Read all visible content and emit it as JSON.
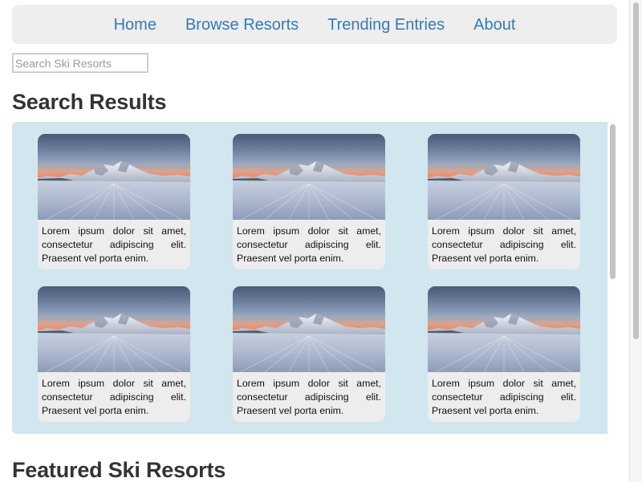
{
  "nav": {
    "items": [
      {
        "label": "Home"
      },
      {
        "label": "Browse Resorts"
      },
      {
        "label": "Trending Entries"
      },
      {
        "label": "About"
      }
    ]
  },
  "search": {
    "placeholder": "Search Ski Resorts",
    "value": ""
  },
  "results": {
    "title": "Search Results",
    "cards": [
      {
        "text": "Lorem ipsum dolor sit amet, consectetur adipiscing elit. Praesent vel porta enim."
      },
      {
        "text": "Lorem ipsum dolor sit amet, consectetur adipiscing elit. Praesent vel porta enim."
      },
      {
        "text": "Lorem ipsum dolor sit amet, consectetur adipiscing elit. Praesent vel porta enim."
      },
      {
        "text": "Lorem ipsum dolor sit amet, consectetur adipiscing elit. Praesent vel porta enim."
      },
      {
        "text": "Lorem ipsum dolor sit amet, consectetur adipiscing elit. Praesent vel porta enim."
      },
      {
        "text": "Lorem ipsum dolor sit amet, consectetur adipiscing elit. Praesent vel porta enim."
      }
    ]
  },
  "featured": {
    "title": "Featured Ski Resorts"
  },
  "colors": {
    "nav_link": "#337ab7",
    "nav_bg": "#eeeeee",
    "panel_bg": "#d1e6ef",
    "card_bg": "#ededed",
    "heading": "#333333"
  }
}
